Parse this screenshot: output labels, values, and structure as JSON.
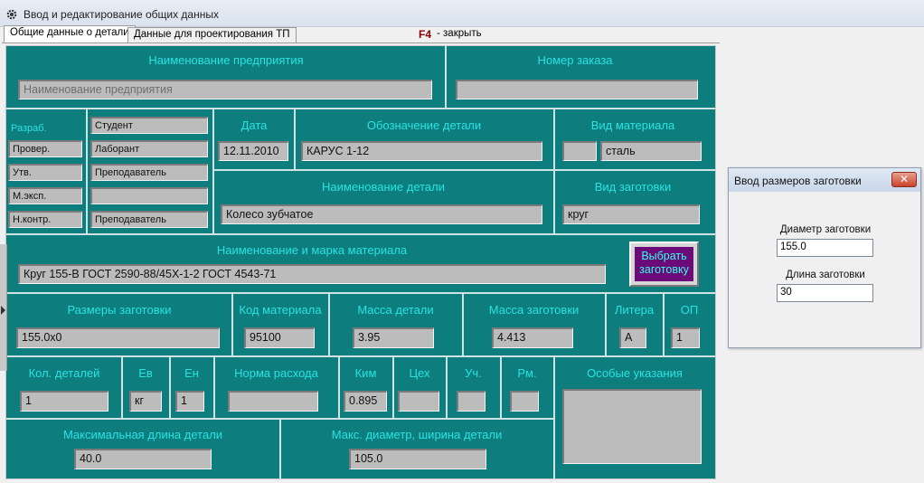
{
  "window": {
    "title": "Ввод и редактирование общих данных",
    "app_icon": "gear-icon"
  },
  "tabs": [
    {
      "label": "Общие данные о детали",
      "active": true
    },
    {
      "label": "Данные для проектирования ТП",
      "active": false
    }
  ],
  "hint": {
    "key": "F4",
    "text": "- закрыть"
  },
  "colors": {
    "panel": "#0e7d7d",
    "label": "#29e3e3",
    "field": "#bcbcbc",
    "button": "#6b0b7a",
    "button_text": "#33ffe6"
  },
  "form": {
    "enterprise": {
      "label": "Наименование предприятия",
      "placeholder": "Наименование предприятия"
    },
    "order": {
      "label": "Номер заказа",
      "value": ""
    },
    "roles": [
      {
        "role": "Разраб.",
        "name": "Студент"
      },
      {
        "role": "Провер.",
        "name": "Лаборант"
      },
      {
        "role": "Утв.",
        "name": "Преподаватель"
      },
      {
        "role": "М.эксп.",
        "name": ""
      },
      {
        "role": "Н.контр.",
        "name": "Преподаватель"
      }
    ],
    "date": {
      "label": "Дата",
      "value": "12.11.2010"
    },
    "designation": {
      "label": "Обозначение детали",
      "value": "КАРУС 1-12"
    },
    "material_type": {
      "label": "Вид материала",
      "code": "",
      "value": "сталь"
    },
    "part_name": {
      "label": "Наименование детали",
      "value": "Колесо зубчатое"
    },
    "blank_type": {
      "label": "Вид заготовки",
      "value": "круг"
    },
    "material": {
      "label": "Наименование и марка материала",
      "value": "Круг 155-В ГОСТ 2590-88/45Х-1-2 ГОСТ 4543-71"
    },
    "select_button": {
      "line1": "Выбрать",
      "line2": "заготовку"
    },
    "blank_size": {
      "label": "Размеры заготовки",
      "value": "155.0x0"
    },
    "material_code": {
      "label": "Код материала",
      "value": "95100"
    },
    "part_mass": {
      "label": "Масса детали",
      "value": "3.95"
    },
    "blank_mass": {
      "label": "Масса заготовки",
      "value": "4.413"
    },
    "litera": {
      "label": "Литера",
      "value": "А"
    },
    "op": {
      "label": "ОП",
      "value": "1"
    },
    "qty": {
      "label": "Кол. деталей",
      "value": "1"
    },
    "ev": {
      "label": "Ев",
      "value": "кг"
    },
    "en": {
      "label": "Ен",
      "value": "1"
    },
    "norm": {
      "label": "Норма расхода",
      "value": ""
    },
    "kim": {
      "label": "Ким",
      "value": "0.895"
    },
    "shop": {
      "label": "Цех",
      "value": ""
    },
    "section": {
      "label": "Уч.",
      "value": ""
    },
    "rm": {
      "label": "Рм.",
      "value": ""
    },
    "special": {
      "label": "Особые указания",
      "value": ""
    },
    "max_length": {
      "label": "Максимальная длина детали",
      "value": "40.0"
    },
    "max_diameter": {
      "label": "Макс. диаметр, ширина детали",
      "value": "105.0"
    }
  },
  "dialog": {
    "title": "Ввод размеров заготовки",
    "close_icon": "close-icon",
    "diameter": {
      "label": "Диаметр заготовки",
      "value": "155.0"
    },
    "length": {
      "label": "Длина заготовки",
      "value": "30"
    }
  }
}
